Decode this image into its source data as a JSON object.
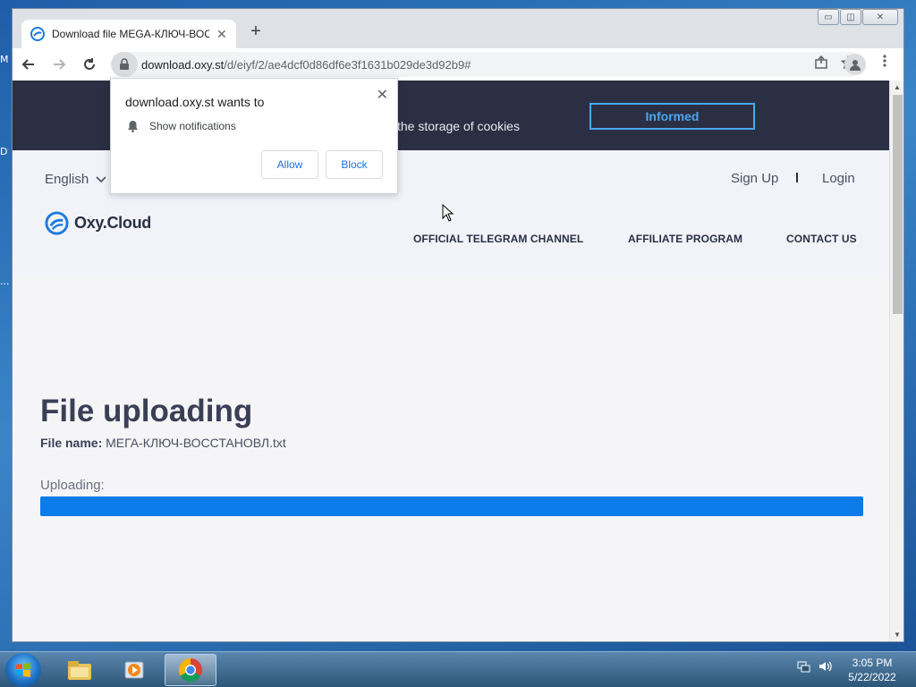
{
  "desktop": {
    "stub_letters": [
      "M",
      "D",
      "..."
    ]
  },
  "browser": {
    "tab_title": "Download file MEGA-КЛЮЧ-ВОССТАНОВЛ.txt",
    "tab_close": "✕",
    "new_tab": "+",
    "url_host": "download.oxy.st",
    "url_path": "/d/eiyf/2/ae4dcf0d86df6e3f1631b029de3d92b9#",
    "window_controls": {
      "minimize": "▭",
      "restore": "◫",
      "close": "✕"
    }
  },
  "notification_prompt": {
    "title": "download.oxy.st wants to",
    "permission": "Show notifications",
    "allow_label": "Allow",
    "block_label": "Block",
    "close": "✕"
  },
  "cookie_banner": {
    "text": "the storage of cookies",
    "button_label": "Informed"
  },
  "header": {
    "language": "English",
    "signup": "Sign Up",
    "login": "Login",
    "logo_text": "Oxy.Cloud",
    "nav": [
      "OFFICIAL TELEGRAM CHANNEL",
      "AFFILIATE PROGRAM",
      "CONTACT US"
    ]
  },
  "main": {
    "title": "File uploading",
    "file_name_label": "File name:",
    "file_name": "МЕГА-КЛЮЧ-ВОССТАНОВЛ.txt",
    "uploading_label": "Uploading:",
    "progress_fraction": 1.0
  },
  "taskbar": {
    "time": "3:05 PM",
    "date": "5/22/2022",
    "apps": [
      "file-explorer-icon",
      "media-player-icon",
      "chrome-icon"
    ]
  },
  "colors": {
    "cookie_bg": "#2b2f44",
    "accent": "#4aa8f0",
    "progress": "#0b7bea",
    "title": "#3a3f56"
  }
}
